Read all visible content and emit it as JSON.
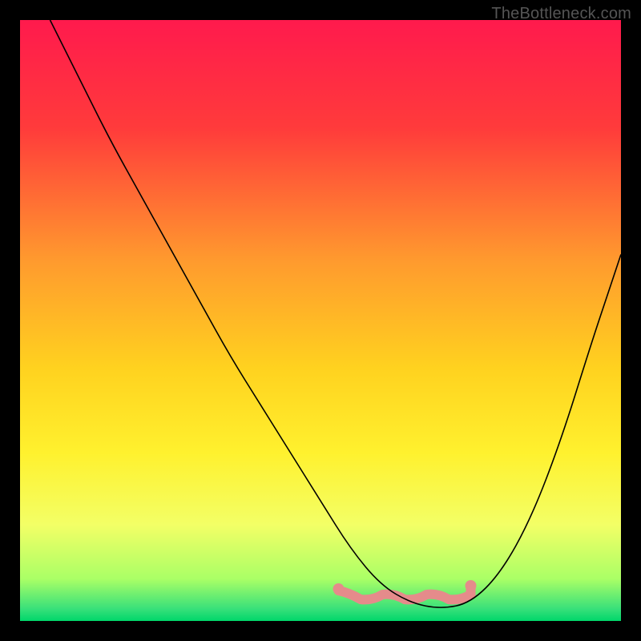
{
  "watermark": "TheBottleneck.com",
  "chart_data": {
    "type": "line",
    "title": "",
    "xlabel": "",
    "ylabel": "",
    "xlim": [
      0,
      100
    ],
    "ylim": [
      0,
      100
    ],
    "grid": false,
    "legend": false,
    "background_gradient_stops": [
      {
        "offset": 0.0,
        "color": "#ff1a4d"
      },
      {
        "offset": 0.18,
        "color": "#ff3b3b"
      },
      {
        "offset": 0.4,
        "color": "#ff9a2e"
      },
      {
        "offset": 0.58,
        "color": "#ffd21f"
      },
      {
        "offset": 0.72,
        "color": "#fff12e"
      },
      {
        "offset": 0.84,
        "color": "#f3ff66"
      },
      {
        "offset": 0.93,
        "color": "#aaff66"
      },
      {
        "offset": 0.98,
        "color": "#38e07a"
      },
      {
        "offset": 1.0,
        "color": "#00d66a"
      }
    ],
    "bottom_highlight": {
      "color": "#e58b8b",
      "y_value": 4,
      "x_start": 53,
      "x_end": 75,
      "stroke_width_px": 12,
      "end_caps": true
    },
    "series": [
      {
        "name": "curve",
        "color": "#000000",
        "stroke_width_px": 1.6,
        "x": [
          5,
          10,
          15,
          20,
          25,
          30,
          35,
          40,
          45,
          50,
          55,
          60,
          65,
          70,
          75,
          80,
          85,
          90,
          95,
          98,
          100
        ],
        "values": [
          100,
          90,
          80,
          71,
          62,
          53,
          44,
          36,
          28,
          20,
          12,
          6,
          3,
          2,
          3,
          8,
          17,
          30,
          46,
          55,
          61
        ]
      }
    ]
  }
}
